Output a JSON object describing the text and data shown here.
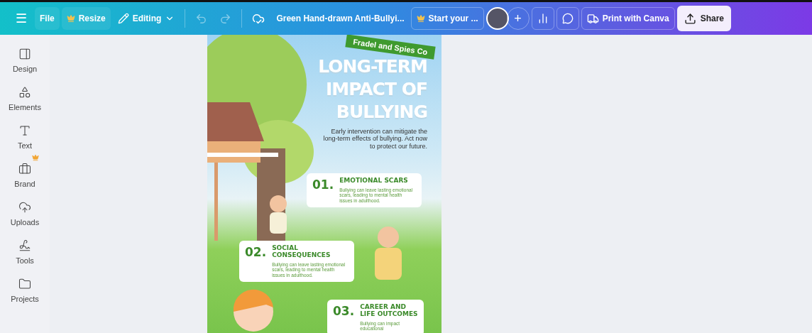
{
  "topbar": {
    "menu": "☰",
    "file": "File",
    "resize": "Resize",
    "mode": "Editing",
    "history": [
      {
        "kind": "undo",
        "disabled": true
      },
      {
        "kind": "redo",
        "disabled": true
      }
    ],
    "title": "Green Hand-drawn Anti-Bullyi...",
    "trial": "Start your ...",
    "add": "+",
    "print": "Print with Canva",
    "share": "Share"
  },
  "sidebar": {
    "items": [
      {
        "kind": "design",
        "label": "Design",
        "premium": false
      },
      {
        "kind": "elements",
        "label": "Elements",
        "premium": false
      },
      {
        "kind": "text",
        "label": "Text",
        "premium": false
      },
      {
        "kind": "brand",
        "label": "Brand",
        "premium": true
      },
      {
        "kind": "uploads",
        "label": "Uploads",
        "premium": false
      },
      {
        "kind": "tools",
        "label": "Tools",
        "premium": false
      },
      {
        "kind": "projects",
        "label": "Projects",
        "premium": false
      }
    ]
  },
  "poster": {
    "ribbon": "Fradel and Spies Co",
    "title": [
      "LONG-TERM",
      "IMPACT OF",
      "BULLYING"
    ],
    "intro": "Early intervention can mitigate the long-term effects of bullying. Act now to protect our future.",
    "cards": [
      {
        "number": "01.",
        "heading": "EMOTIONAL SCARS",
        "text": "Bullying can leave lasting emotional scars, leading to mental health issues in adulthood."
      },
      {
        "number": "02.",
        "heading": "SOCIAL CONSEQUENCES",
        "text": "Bullying can leave lasting emotional scars, leading to mental health issues in adulthood."
      },
      {
        "number": "03.",
        "heading": "CAREER AND LIFE OUTCOMES",
        "text": "Bullying can impact educational"
      }
    ]
  }
}
